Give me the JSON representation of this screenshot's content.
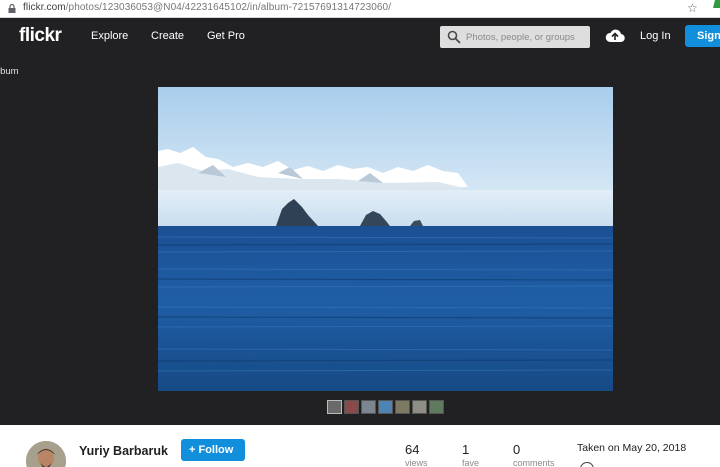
{
  "browser": {
    "url_main": "flickr.com",
    "url_path": "/photos/123036053@N04/42231645102/in/album-72157691314723060/"
  },
  "header": {
    "logo": "flickr",
    "nav": [
      "Explore",
      "Create",
      "Get Pro"
    ],
    "search_placeholder": "Photos, people, or groups",
    "login_label": "Log In",
    "signup_label": "Sign"
  },
  "viewer": {
    "back_label": "lbum",
    "thumbnail_count": 7
  },
  "info": {
    "author": "Yuriy Barbaruk",
    "follow_label": "Follow",
    "views_count": "64",
    "views_label": "views",
    "faves_count": "1",
    "faves_label": "fave",
    "comments_count": "0",
    "comments_label": "comments",
    "taken": "Taken on May 20, 2018"
  },
  "colors": {
    "header_bg": "#212124",
    "accent_blue": "#128fdc",
    "sea": "#1a4f8f",
    "sky": "#bfdcf2"
  }
}
